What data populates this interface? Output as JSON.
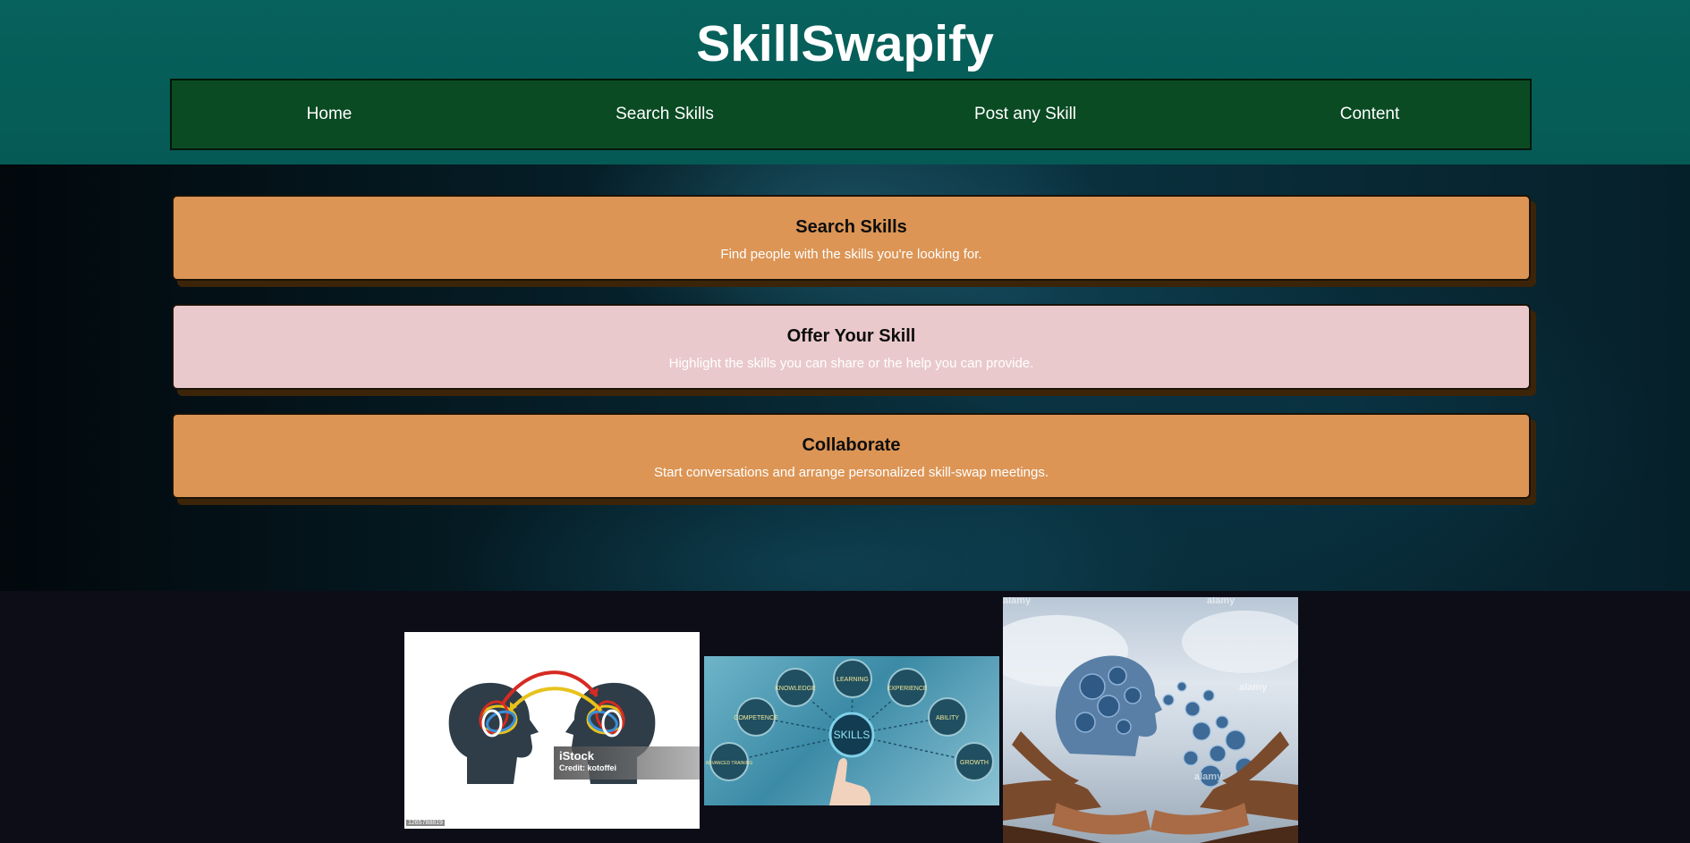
{
  "header": {
    "title": "SkillSwapify"
  },
  "nav": {
    "items": [
      {
        "label": "Home"
      },
      {
        "label": "Search Skills"
      },
      {
        "label": "Post any Skill"
      },
      {
        "label": "Content"
      }
    ]
  },
  "cards": [
    {
      "title": "Search Skills",
      "description": "Find people with the skills you're looking for."
    },
    {
      "title": "Offer Your Skill",
      "description": "Highlight the skills you can share or the help you can provide."
    },
    {
      "title": "Collaborate",
      "description": "Start conversations and arrange personalized skill-swap meetings."
    }
  ],
  "gallery": {
    "image1": {
      "watermark_brand": "iStock",
      "watermark_credit": "Credit: kotoffei",
      "stock_id": "1265788819"
    },
    "image2": {
      "center_label": "SKILLS",
      "bubbles": [
        "KNOWLEDGE",
        "LEARNING",
        "EXPERIENCE",
        "COMPETENCE",
        "ABILITY",
        "ADVANCED TRAINING",
        "GROWTH"
      ]
    },
    "image3": {
      "watermark": "alamy"
    }
  },
  "colors": {
    "header_bg": "#07615c",
    "nav_bg": "#0a4b23",
    "card_orange": "#dc9555",
    "card_pink": "#e9c9cc",
    "gallery_bg": "#0c0d16"
  }
}
